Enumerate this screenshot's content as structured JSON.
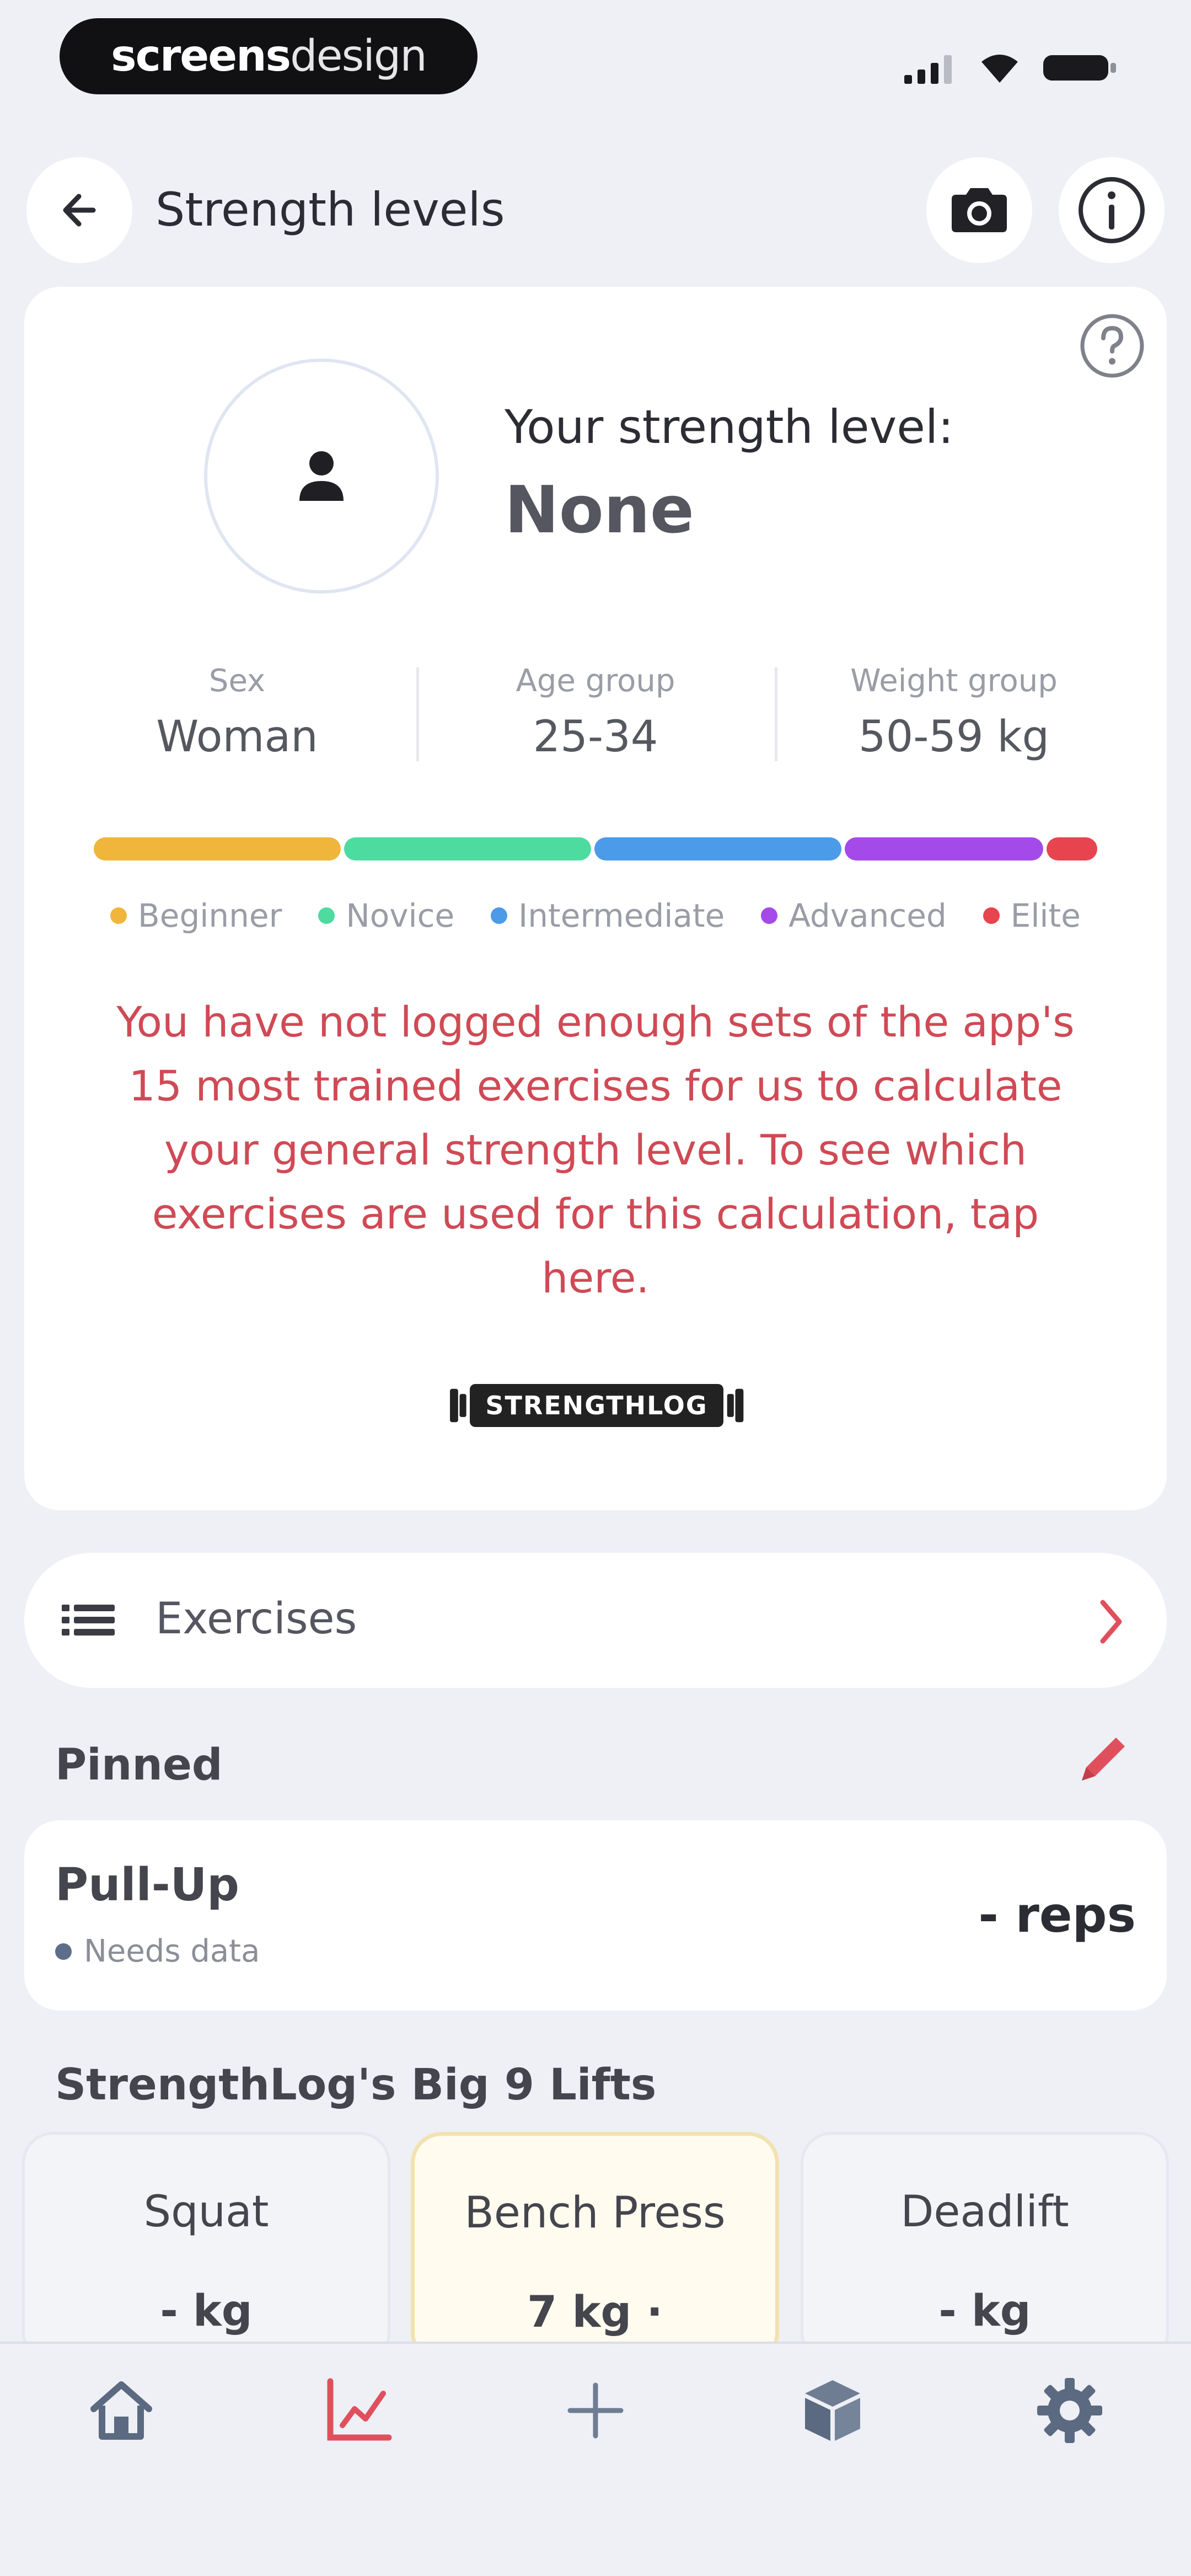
{
  "status_bar": {
    "brand_bold": "screens",
    "brand_light": "design"
  },
  "header": {
    "title": "Strength levels",
    "back_icon": "back-arrow-icon",
    "camera_icon": "camera-icon",
    "info_icon": "info-icon"
  },
  "strength": {
    "level_label": "Your strength level:",
    "level_value": "None",
    "help_icon": "help-icon",
    "stats": [
      {
        "label": "Sex",
        "value": "Woman"
      },
      {
        "label": "Age group",
        "value": "25-34"
      },
      {
        "label": "Weight group",
        "value": "50-59 kg"
      }
    ],
    "levels": [
      {
        "name": "Beginner",
        "color": "#f0b63b"
      },
      {
        "name": "Novice",
        "color": "#4ddba0"
      },
      {
        "name": "Intermediate",
        "color": "#4c9be9"
      },
      {
        "name": "Advanced",
        "color": "#a44ae8"
      },
      {
        "name": "Elite",
        "color": "#e8444f"
      }
    ],
    "warning": "You have not logged enough sets of the app's 15 most trained exercises for us to calculate your general strength level. To see which exercises are used for this calculation, tap here.",
    "logo_text": "STRENGTHLOG"
  },
  "exercises_link": {
    "label": "Exercises"
  },
  "pinned": {
    "title": "Pinned",
    "item": {
      "name": "Pull-Up",
      "status": "Needs data",
      "value": "- reps"
    }
  },
  "big9": {
    "title": "StrengthLog's Big 9 Lifts",
    "lifts": [
      {
        "name": "Squat",
        "value": "- kg"
      },
      {
        "name": "Bench Press",
        "value": "7 kg ·"
      },
      {
        "name": "Deadlift",
        "value": "- kg"
      }
    ]
  },
  "colors": {
    "accent": "#e0505c",
    "background": "#eef0f6"
  }
}
